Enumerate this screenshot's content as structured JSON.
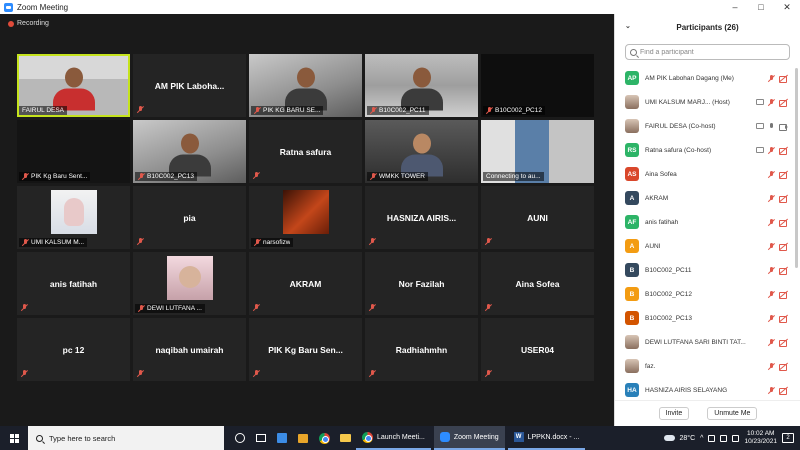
{
  "window": {
    "title": "Zoom Meeting",
    "minimize": "–",
    "maximize": "□",
    "close": "✕"
  },
  "recording_label": "Recording",
  "tiles": [
    {
      "label": "FAIRUL DESA",
      "active": true
    },
    {
      "big_name": "AM PIK Laboha..."
    },
    {
      "label": "PIK KG BARU SE..."
    },
    {
      "label": "B10C002_PC11"
    },
    {
      "label": "B10C002_PC12"
    },
    {
      "label": "PIK Kg Baru Sent..."
    },
    {
      "label": "B10C002_PC13"
    },
    {
      "big_name": "Ratna safura"
    },
    {
      "label": "WMKK TOWER"
    },
    {
      "label": "Connecting to au..."
    },
    {
      "label": "UMI KALSUM M..."
    },
    {
      "big_name": "pia"
    },
    {
      "label": "narsofizw"
    },
    {
      "big_name": "HASNIZA AIRIS..."
    },
    {
      "big_name": "AUNI"
    },
    {
      "big_name": "anis fatihah"
    },
    {
      "label": "DEWI LUTFANA ..."
    },
    {
      "big_name": "AKRAM"
    },
    {
      "big_name": "Nor Fazilah"
    },
    {
      "big_name": "Aina Sofea"
    },
    {
      "big_name": "pc 12"
    },
    {
      "big_name": "naqibah umairah"
    },
    {
      "big_name": "PIK Kg Baru Sen..."
    },
    {
      "big_name": "Radhiahmhn"
    },
    {
      "big_name": "USER04"
    }
  ],
  "participants_panel": {
    "title": "Participants (26)",
    "search_placeholder": "Find a participant",
    "participants": [
      {
        "initials": "AP",
        "name": "AM PIK Labohan Dagang (Me)",
        "color": "#2db467"
      },
      {
        "initials": "",
        "name": "UMI KALSUM MARJ... (Host)",
        "color": ""
      },
      {
        "initials": "",
        "name": "FAIRUL DESA (Co-host)",
        "color": ""
      },
      {
        "initials": "RS",
        "name": "Ratna safura (Co-host)",
        "color": "#2db467"
      },
      {
        "initials": "AS",
        "name": "Aina Sofea",
        "color": "#d9472b"
      },
      {
        "initials": "A",
        "name": "AKRAM",
        "color": "#34495e"
      },
      {
        "initials": "AF",
        "name": "anis fatihah",
        "color": "#2db467"
      },
      {
        "initials": "A",
        "name": "AUNI",
        "color": "#f39c12"
      },
      {
        "initials": "B",
        "name": "B10C002_PC11",
        "color": "#34495e"
      },
      {
        "initials": "B",
        "name": "B10C002_PC12",
        "color": "#f39c12"
      },
      {
        "initials": "B",
        "name": "B10C002_PC13",
        "color": "#d35400"
      },
      {
        "initials": "",
        "name": "DEWI LUTFANA SARI BINTI TAT...",
        "color": ""
      },
      {
        "initials": "",
        "name": "faz.",
        "color": ""
      },
      {
        "initials": "HA",
        "name": "HASNIZA AIRIS SELAYANG",
        "color": "#2980b9"
      }
    ],
    "invite_label": "Invite",
    "unmute_label": "Unmute Me"
  },
  "taskbar": {
    "search_placeholder": "Type here to search",
    "apps": [
      {
        "label": "Launch Meeti...",
        "icon": "chrome-icon"
      },
      {
        "label": "Zoom Meeting",
        "icon": "zoom-icon"
      },
      {
        "label": "LPPKN.docx - ...",
        "icon": "word-icon"
      }
    ],
    "temperature": "28°C",
    "time": "10:02 AM",
    "date": "10/23/2021",
    "notification_count": "2"
  }
}
